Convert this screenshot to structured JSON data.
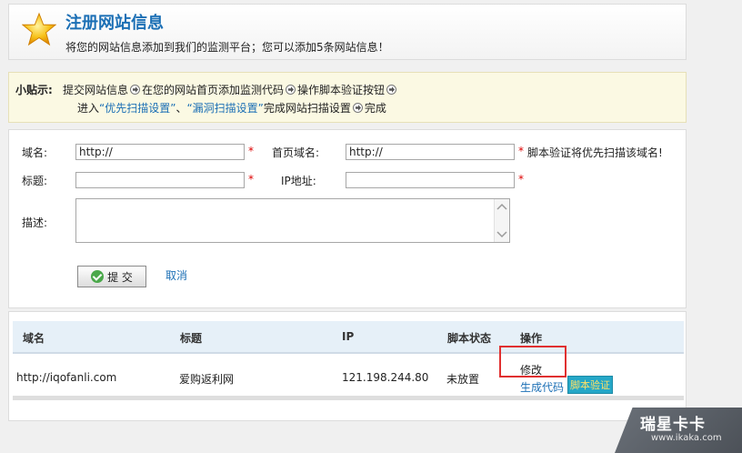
{
  "header": {
    "title": "注册网站信息",
    "subtitle": "将您的网站信息添加到我们的监测平台；您可以添加5条网站信息！"
  },
  "tips": {
    "label": "小贴示:",
    "step1": "提交网站信息",
    "step2": "在您的网站首页添加监测代码",
    "step3": "操作脚本验证按钮",
    "line2_prefix": "进入",
    "link1": "“优先扫描设置”",
    "sep": "、",
    "link2": "“漏洞扫描设置”",
    "line2_mid": "完成网站扫描设置",
    "line2_end": "完成"
  },
  "form": {
    "domain_label": "域名:",
    "domain_value": "http://",
    "homepage_label": "首页域名:",
    "homepage_value": "http://",
    "required_mark": "*",
    "homepage_hint": "脚本验证将优先扫描该域名!",
    "title_label": "标题:",
    "title_value": "",
    "ip_label": "IP地址:",
    "ip_value": "",
    "desc_label": "描述:",
    "desc_value": "",
    "submit_label": "提 交",
    "cancel_label": "取消"
  },
  "table": {
    "columns": [
      "域名",
      "标题",
      "IP",
      "脚本状态",
      "操作"
    ],
    "rows": [
      {
        "domain": "http://iqofanli.com",
        "title": "爱购返利网",
        "ip": "121.198.244.80",
        "status": "未放置",
        "edit": "修改",
        "gen_code": "生成代码",
        "verify": "脚本验证"
      }
    ]
  },
  "watermark": {
    "brand": "瑞星卡卡",
    "url": "www.ikaka.com"
  },
  "colors": {
    "accent": "#1b6fb5",
    "required": "#dd0000",
    "tips_bg": "#fbf9e3",
    "table_header_bg": "#e6f0f8",
    "highlight": "#e03030",
    "verify_badge": "#25a7c7"
  }
}
